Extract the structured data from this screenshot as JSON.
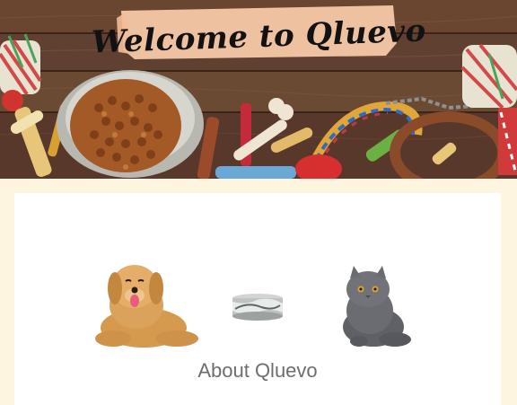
{
  "hero": {
    "title": "Welcome to Qluevo",
    "colors": {
      "wood": "#5a3a26",
      "brush": "#f6c9a6",
      "kibble": "#a35a26"
    }
  },
  "about": {
    "heading": "About Qluevo"
  },
  "images": {
    "dog": "golden-retriever-image",
    "tin": "pet-food-tin-image",
    "cat": "grey-cat-image"
  }
}
